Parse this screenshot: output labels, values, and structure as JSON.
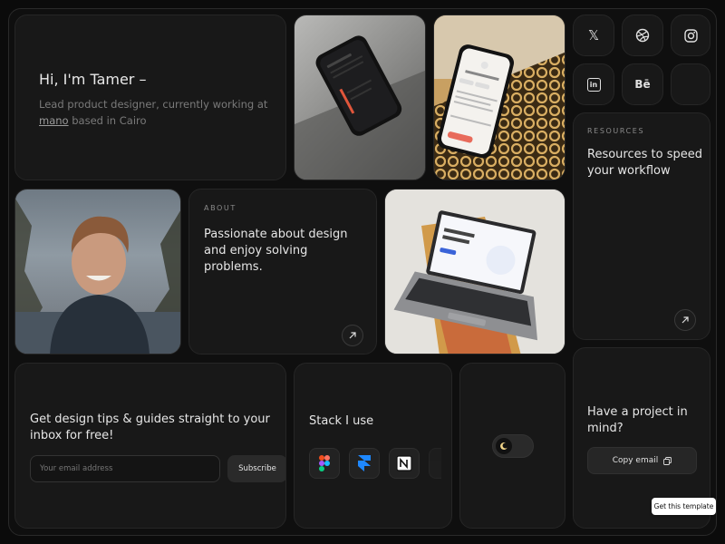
{
  "intro": {
    "greeting": "Hi, I'm Tamer –",
    "line1": "Lead product designer, currently working at",
    "company": "mano",
    "line2": " based in Cairo"
  },
  "about": {
    "eyebrow": "ABOUT",
    "text": "Passionate about design and enjoy solving problems."
  },
  "resources": {
    "eyebrow": "RESOURCES",
    "text": "Resources to speed your workflow"
  },
  "newsletter": {
    "title": "Get design tips & guides straight to your inbox for free!",
    "email_placeholder": "Your email address",
    "subscribe_label": "Subscribe"
  },
  "stack": {
    "title": "Stack I use",
    "tools": [
      "figma-icon",
      "framer-icon",
      "notion-icon"
    ]
  },
  "project": {
    "title": "Have a project in mind?",
    "copy_label": "Copy email"
  },
  "socials": {
    "x_glyph": "𝕏",
    "linkedin_glyph": "in",
    "behance_glyph": "Bē"
  },
  "template_badge": "Get this template",
  "colors": {
    "background": "#0b0b0b",
    "card": "#181818",
    "text": "#e6e6e6",
    "muted": "#7a7a7a"
  }
}
